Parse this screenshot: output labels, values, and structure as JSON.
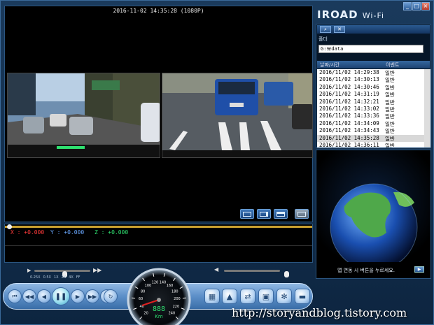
{
  "window": {
    "brand": "IROAD",
    "brand_suffix": "Wi-Fi",
    "min_icon": "minimize-icon",
    "max_icon": "maximize-icon",
    "close_icon": "close-icon"
  },
  "video": {
    "timestamp": "2016-11-02 14:35:28 (1080P)",
    "front_cam": "front-camera-feed",
    "rear_cam": "rear-camera-feed"
  },
  "sensor": {
    "x": "X : +0.000",
    "y": "Y : +0.000",
    "z": "Z : +0.000"
  },
  "speed": {
    "labels": [
      "0.25X",
      "0.5X",
      "1X",
      "2X",
      "4X",
      "FF"
    ]
  },
  "gauge": {
    "value": "888",
    "unit": "Km",
    "ticks": [
      "20",
      "40",
      "60",
      "80",
      "100",
      "120",
      "140",
      "160",
      "180",
      "200",
      "220",
      "240"
    ]
  },
  "sidebar": {
    "folder_label": "폴더",
    "folder_path": "G:￦data",
    "col_time": "날짜/시간",
    "col_event": "이벤트",
    "rows": [
      {
        "time": "2016/11/02 14:29:38",
        "event": "일반"
      },
      {
        "time": "2016/11/02 14:30:13",
        "event": "일반"
      },
      {
        "time": "2016/11/02 14:30:46",
        "event": "일반"
      },
      {
        "time": "2016/11/02 14:31:19",
        "event": "일반"
      },
      {
        "time": "2016/11/02 14:32:21",
        "event": "일반"
      },
      {
        "time": "2016/11/02 14:33:02",
        "event": "일반"
      },
      {
        "time": "2016/11/02 14:33:36",
        "event": "일반"
      },
      {
        "time": "2016/11/02 14:34:09",
        "event": "일반"
      },
      {
        "time": "2016/11/02 14:34:43",
        "event": "일반"
      },
      {
        "time": "2016/11/02 14:35:28",
        "event": "일반"
      },
      {
        "time": "2016/11/02 14:36:11",
        "event": "일반"
      }
    ],
    "selected_index": 9
  },
  "globe": {
    "prompt": "맵 연동 시 버튼을 누르세요."
  },
  "watermark": "http://storyandblog.tistory.com"
}
